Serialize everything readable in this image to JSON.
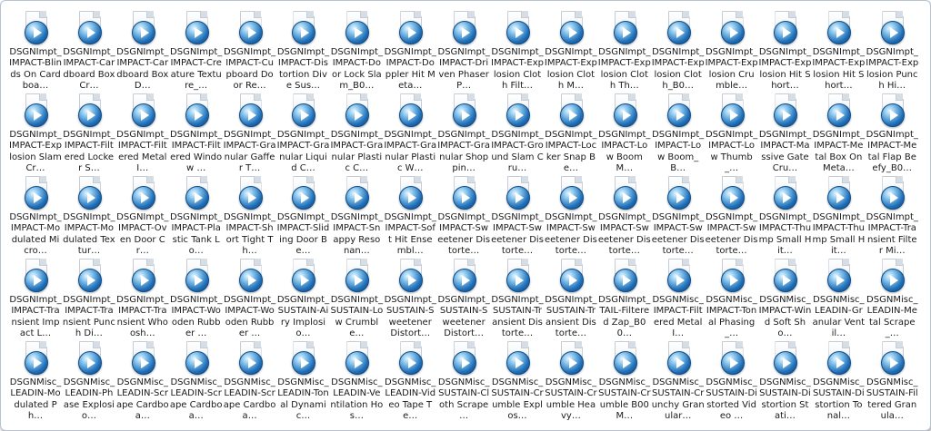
{
  "files": [
    "DSGNImpt_IMPACT-Blinds On Cardboa…",
    "DSGNImpt_IMPACT-Cardboard Box Cr…",
    "DSGNImpt_IMPACT-Cardboard Box D…",
    "DSGNImpt_IMPACT-Creature Texture_…",
    "DSGNImpt_IMPACT-Cupboard Door Re…",
    "DSGNImpt_IMPACT-Distortion Dive Sus…",
    "DSGNImpt_IMPACT-Door Lock Slam_B0…",
    "DSGNImpt_IMPACT-Doppler Hit Meta…",
    "DSGNImpt_IMPACT-Driven Phaser P…",
    "DSGNImpt_IMPACT-Explosion Cloth Filt…",
    "DSGNImpt_IMPACT-Explosion Cloth M…",
    "DSGNImpt_IMPACT-Explosion Cloth Th…",
    "DSGNImpt_IMPACT-Explosion Cloth_B0…",
    "DSGNImpt_IMPACT-Explosion Crumble…",
    "DSGNImpt_IMPACT-Explosion Hit Short…",
    "DSGNImpt_IMPACT-Explosion Hit Short…",
    "DSGNImpt_IMPACT-Explosion Punch Hi…",
    "DSGNImpt_IMPACT-Explosion Slam Cr…",
    "DSGNImpt_IMPACT-Filtered Locker S…",
    "DSGNImpt_IMPACT-Filtered Metal I…",
    "DSGNImpt_IMPACT-Filtered Window …",
    "DSGNImpt_IMPACT-Granular Gaffer T…",
    "DSGNImpt_IMPACT-Granular Liquid C…",
    "DSGNImpt_IMPACT-Granular Plastic C…",
    "DSGNImpt_IMPACT-Granular Plastic W…",
    "DSGNImpt_IMPACT-Granular Shoppin…",
    "DSGNImpt_IMPACT-Ground Slam Cru…",
    "DSGNImpt_IMPACT-Locker Snap Be…",
    "DSGNImpt_IMPACT-Low Boom M…",
    "DSGNImpt_IMPACT-Low Boom_B…",
    "DSGNImpt_IMPACT-Low Thumb_…",
    "DSGNImpt_IMPACT-Massive Gate Cru…",
    "DSGNImpt_IMPACT-Metal Box On Meta…",
    "DSGNImpt_IMPACT-Metal Flap Beefy_B0…",
    "DSGNImpt_IMPACT-Modulated Micro…",
    "DSGNImpt_IMPACT-Modulated Textur…",
    "DSGNImpt_IMPACT-Oven Door Cr…",
    "DSGNImpt_IMPACT-Plastic Tank Lo…",
    "DSGNImpt_IMPACT-Short Tight Th…",
    "DSGNImpt_IMPACT-Sliding Door Be…",
    "DSGNImpt_IMPACT-Snappy Resonan…",
    "DSGNImpt_IMPACT-Soft Hit Ensembl…",
    "DSGNImpt_IMPACT-Sweetener Distorte…",
    "DSGNImpt_IMPACT-Sweetener Distorte…",
    "DSGNImpt_IMPACT-Sweetener Distorte…",
    "DSGNImpt_IMPACT-Sweetener Distorte…",
    "DSGNImpt_IMPACT-Sweetener Distorte…",
    "DSGNImpt_IMPACT-Sweetener Distorte…",
    "DSGNImpt_IMPACT-Thump Small Hit…",
    "DSGNImpt_IMPACT-Thump Small Hit…",
    "DSGNImpt_IMPACT-Transient Filter Mi…",
    "DSGNImpt_IMPACT-Transient Impact L…",
    "DSGNImpt_IMPACT-Transient Punch Di…",
    "DSGNImpt_IMPACT-Transient Whoosh…",
    "DSGNImpt_IMPACT-Wooden Rubber …",
    "DSGNImpt_IMPACT-Wooden Rubber …",
    "DSGNImpt_SUSTAIN-Airy Implosio…",
    "DSGNImpt_SUSTAIN-Low Crumble…",
    "DSGNImpt_SUSTAIN-Sweetener Distort…",
    "DSGNImpt_SUSTAIN-Sweetener Distort…",
    "DSGNImpt_SUSTAIN-Transient Distorte…",
    "DSGNImpt_SUSTAIN-Transient Distorte…",
    "DSGNImpt_TAIL-Filtered Zap_B00…",
    "DSGNMisc_IMPACT-Filtered Metal I…",
    "DSGNMisc_IMPACT-Tonal Phasing_…",
    "DSGNMisc_IMPACT-Wind Soft Sho…",
    "DSGNMisc_LEADIN-Granular Ventil…",
    "DSGNMisc_LEADIN-Metal Scrape_…",
    "DSGNMisc_LEADIN-Modulated Ph…",
    "DSGNMisc_LEADIN-Phase Explosio…",
    "DSGNMisc_LEADIN-Scrape Cardboa…",
    "DSGNMisc_LEADIN-Scrape Cardboa…",
    "DSGNMisc_LEADIN-Scrape Cardboa…",
    "DSGNMisc_LEADIN-Tonal Dynamic…",
    "DSGNMisc_LEADIN-Ventilation Hos…",
    "DSGNMisc_LEADIN-Video Tape Te…",
    "DSGNMisc_SUSTAIN-Cloth Scrape …",
    "DSGNMisc_SUSTAIN-Crumble Explos…",
    "DSGNMisc_SUSTAIN-Crumble Heavy…",
    "DSGNMisc_SUSTAIN-Crumble B00M…",
    "DSGNMisc_SUSTAIN-Crunchy Granular…",
    "DSGNMisc_SUSTAIN-Distorted Video …",
    "DSGNMisc_SUSTAIN-Distortion Stati…",
    "DSGNMisc_SUSTAIN-Distortion Tonal…",
    "DSGNMisc_SUSTAIN-Filtered Granula…"
  ],
  "icon": "audio-file-icon"
}
